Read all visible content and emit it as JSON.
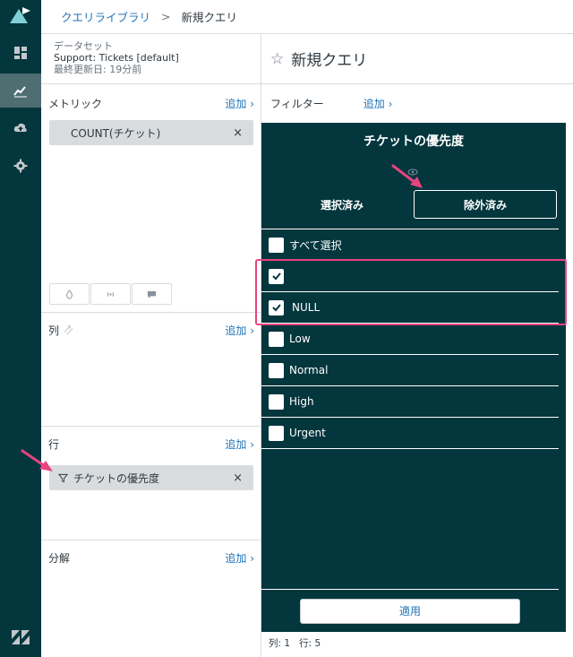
{
  "topbar": {
    "crumb_library": "クエリライブラリ",
    "separator": ">",
    "crumb_current": "新規クエリ"
  },
  "dataset": {
    "label": "データセット",
    "name": "Support: Tickets [default]",
    "updated": "最終更新日: 19分前"
  },
  "metrics": {
    "title": "メトリック",
    "add": "追加 ›",
    "pill": "COUNT(チケット)",
    "remove": "×"
  },
  "columns": {
    "title": "列",
    "add": "追加 ›"
  },
  "rows": {
    "title": "行",
    "add": "追加 ›",
    "pill": "チケットの優先度",
    "remove": "×"
  },
  "breakdown": {
    "title": "分解",
    "add": "追加 ›"
  },
  "query": {
    "title": "新規クエリ"
  },
  "filter_bar": {
    "label": "フィルター",
    "add": "追加 ›"
  },
  "filter_panel": {
    "title": "チケットの優先度",
    "tab_selected": "選択済み",
    "tab_excluded": "除外済み",
    "select_all": "すべて選択",
    "items": [
      {
        "label": "",
        "checked": true
      },
      {
        "label": "NULL",
        "checked": true
      },
      {
        "label": "Low",
        "checked": false
      },
      {
        "label": "Normal",
        "checked": false
      },
      {
        "label": "High",
        "checked": false
      },
      {
        "label": "Urgent",
        "checked": false
      }
    ],
    "apply": "適用"
  },
  "status": {
    "columns": "列: 1",
    "rows": "行: 5"
  },
  "colors": {
    "rail": "#03363d",
    "link": "#1f73b7",
    "annotation": "#e8437f"
  }
}
